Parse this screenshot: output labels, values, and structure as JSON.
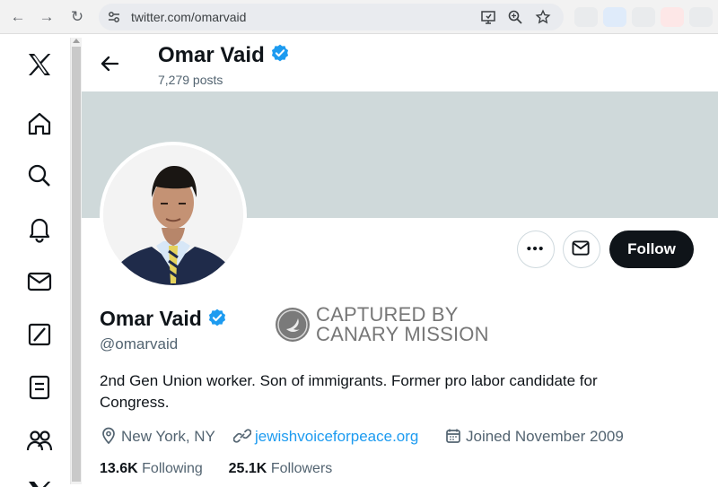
{
  "browser": {
    "url": "twitter.com/omarvaid",
    "icons": [
      "back-arrow-icon",
      "forward-arrow-icon",
      "reload-icon",
      "site-settings-icon",
      "cast-icon",
      "zoom-icon",
      "star-icon"
    ]
  },
  "sidebar": {
    "items": [
      {
        "name": "x-logo-icon"
      },
      {
        "name": "home-icon"
      },
      {
        "name": "search-icon"
      },
      {
        "name": "notifications-icon"
      },
      {
        "name": "messages-icon"
      },
      {
        "name": "grok-icon"
      },
      {
        "name": "lists-icon"
      },
      {
        "name": "communities-icon"
      }
    ]
  },
  "header": {
    "title": "Omar Vaid",
    "posts_count": "7,279 posts"
  },
  "profile": {
    "display_name": "Omar Vaid",
    "handle": "@omarvaid",
    "bio": "2nd Gen Union worker. Son of immigrants. Former pro labor candidate for Congress.",
    "location": "New York, NY",
    "website": "jewishvoiceforpeace.org",
    "joined": "Joined November 2009",
    "following_count": "13.6K",
    "following_label": "Following",
    "followers_count": "25.1K",
    "followers_label": "Followers",
    "follow_button": "Follow"
  },
  "watermark": {
    "line1": "CAPTURED BY",
    "line2": "CANARY MISSION"
  },
  "colors": {
    "banner": "#cfd9da",
    "verified": "#1d9bf0",
    "link": "#1d9bf0",
    "follow_button": "#0f1419"
  }
}
